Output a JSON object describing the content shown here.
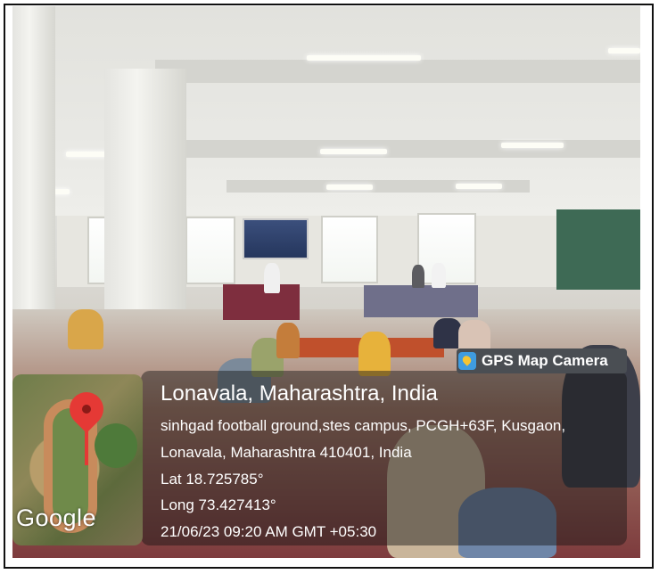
{
  "gps_badge": {
    "label": "GPS Map Camera",
    "icon": "gps-map-camera-icon"
  },
  "location": {
    "title": "Lonavala, Maharashtra, India",
    "address_line1": "sinhgad football ground,stes campus, PCGH+63F, Kusgaon,",
    "address_line2": "Lonavala, Maharashtra 410401, India",
    "latitude": "Lat 18.725785°",
    "longitude": "Long 73.427413°",
    "datetime": "21/06/23 09:20 AM GMT +05:30"
  },
  "map": {
    "attribution": "Google",
    "pin_color": "#e53935"
  },
  "colors": {
    "overlay": "#141414",
    "badge_bg": "#4a4e53",
    "text": "#ffffff"
  }
}
